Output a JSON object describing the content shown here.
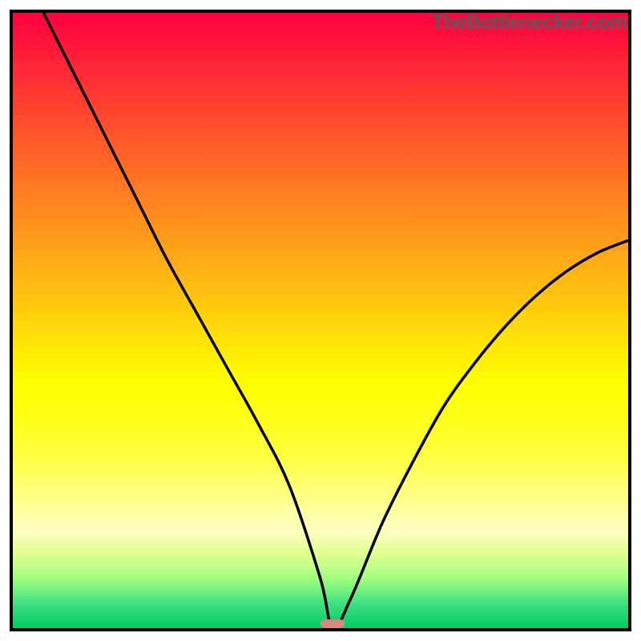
{
  "watermark": "TheBottlenecker.com",
  "chart_data": {
    "type": "line",
    "title": "",
    "xlabel": "",
    "ylabel": "",
    "xlim": [
      0,
      100
    ],
    "ylim": [
      0,
      100
    ],
    "x": [
      5,
      10,
      15,
      20,
      25,
      30,
      35,
      40,
      45,
      50,
      52,
      55,
      60,
      65,
      70,
      75,
      80,
      85,
      90,
      95,
      100
    ],
    "values": [
      100,
      90,
      80,
      70,
      60,
      51,
      42,
      33,
      23,
      8,
      0,
      5,
      17,
      27,
      36,
      43,
      49,
      54,
      58,
      61,
      63
    ],
    "gradient_colors": {
      "top": "#ff0040",
      "middle": "#ffff00",
      "bottom": "#00cc66"
    },
    "marker": {
      "x": 52,
      "y": 0
    }
  }
}
